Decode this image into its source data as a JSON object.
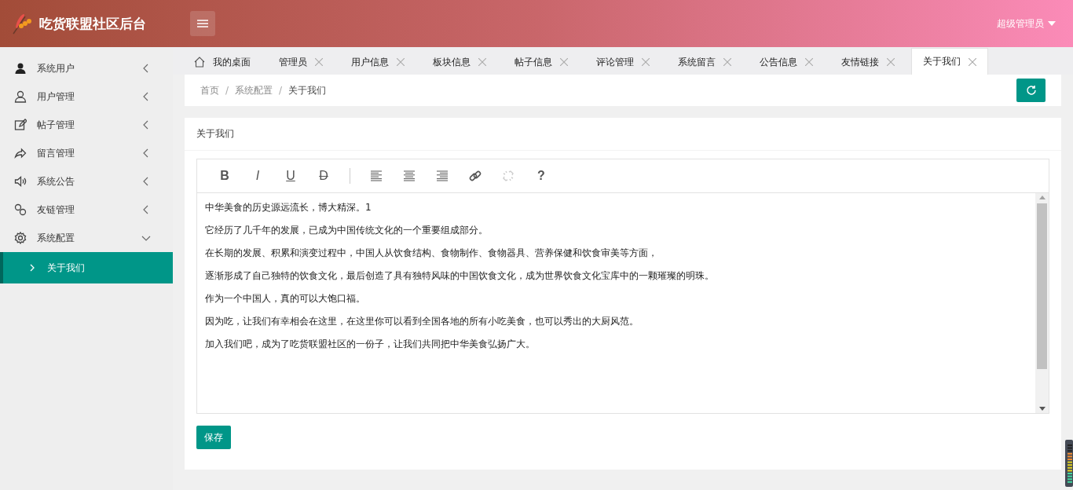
{
  "header": {
    "title": "吃货联盟社区后台",
    "user": "超级管理员"
  },
  "sidebar": {
    "items": [
      {
        "kind": "user-solid",
        "label": "系统用户",
        "expanded": false
      },
      {
        "kind": "user",
        "label": "用户管理",
        "expanded": false
      },
      {
        "kind": "edit",
        "label": "帖子管理",
        "expanded": false
      },
      {
        "kind": "share",
        "label": "留言管理",
        "expanded": false
      },
      {
        "kind": "speaker",
        "label": "系统公告",
        "expanded": false
      },
      {
        "kind": "link",
        "label": "友链管理",
        "expanded": false
      },
      {
        "kind": "gear",
        "label": "系统配置",
        "expanded": true,
        "children": [
          {
            "label": "关于我们",
            "selected": true
          }
        ]
      }
    ]
  },
  "tabs": [
    {
      "kind": "home",
      "label": "我的桌面",
      "selected": false
    },
    {
      "kind": "closable",
      "label": "管理员",
      "selected": false
    },
    {
      "kind": "closable",
      "label": "用户信息",
      "selected": false
    },
    {
      "kind": "closable",
      "label": "板块信息",
      "selected": false
    },
    {
      "kind": "closable",
      "label": "帖子信息",
      "selected": false
    },
    {
      "kind": "closable",
      "label": "评论管理",
      "selected": false
    },
    {
      "kind": "closable",
      "label": "系统留言",
      "selected": false
    },
    {
      "kind": "closable",
      "label": "公告信息",
      "selected": false
    },
    {
      "kind": "closable",
      "label": "友情链接",
      "selected": false
    },
    {
      "kind": "closable",
      "label": "关于我们",
      "selected": true
    }
  ],
  "breadcrumb": [
    {
      "kind": "link",
      "label": "首页"
    },
    {
      "kind": "separator",
      "label": "/"
    },
    {
      "kind": "link",
      "label": "系统配置"
    },
    {
      "kind": "separator",
      "label": "/"
    },
    {
      "kind": "current",
      "label": "关于我们"
    }
  ],
  "card": {
    "title": "关于我们",
    "toolbar": [
      {
        "kind": "bold",
        "label": "B",
        "disabled": false
      },
      {
        "kind": "italic",
        "label": "I",
        "disabled": false
      },
      {
        "kind": "underline",
        "label": "U",
        "disabled": false
      },
      {
        "kind": "strike",
        "label": "D",
        "disabled": false
      },
      {
        "kind": "separator"
      },
      {
        "kind": "align-left",
        "disabled": false
      },
      {
        "kind": "align-center",
        "disabled": false
      },
      {
        "kind": "align-right",
        "disabled": false
      },
      {
        "kind": "link",
        "disabled": false
      },
      {
        "kind": "unlink",
        "disabled": true
      },
      {
        "kind": "help",
        "label": "?",
        "disabled": false
      }
    ],
    "content": [
      "中华美食的历史源远流长，博大精深。1",
      "它经历了几千年的发展，已成为中国传统文化的一个重要组成部分。",
      "在长期的发展、积累和演变过程中，中国人从饮食结构、食物制作、食物器具、营养保健和饮食审美等方面，",
      "逐渐形成了自己独特的饮食文化，最后创造了具有独特风味的中国饮食文化，成为世界饮食文化宝库中的一颗璀璨的明珠。",
      "作为一个中国人，真的可以大饱口福。",
      "因为吃，让我们有幸相会在这里，在这里你可以看到全国各地的所有小吃美食，也可以秀出的大厨风范。",
      "加入我们吧，成为了吃货联盟社区的一份子，让我们共同把中华美食弘扬广大。"
    ],
    "save": "保存"
  }
}
